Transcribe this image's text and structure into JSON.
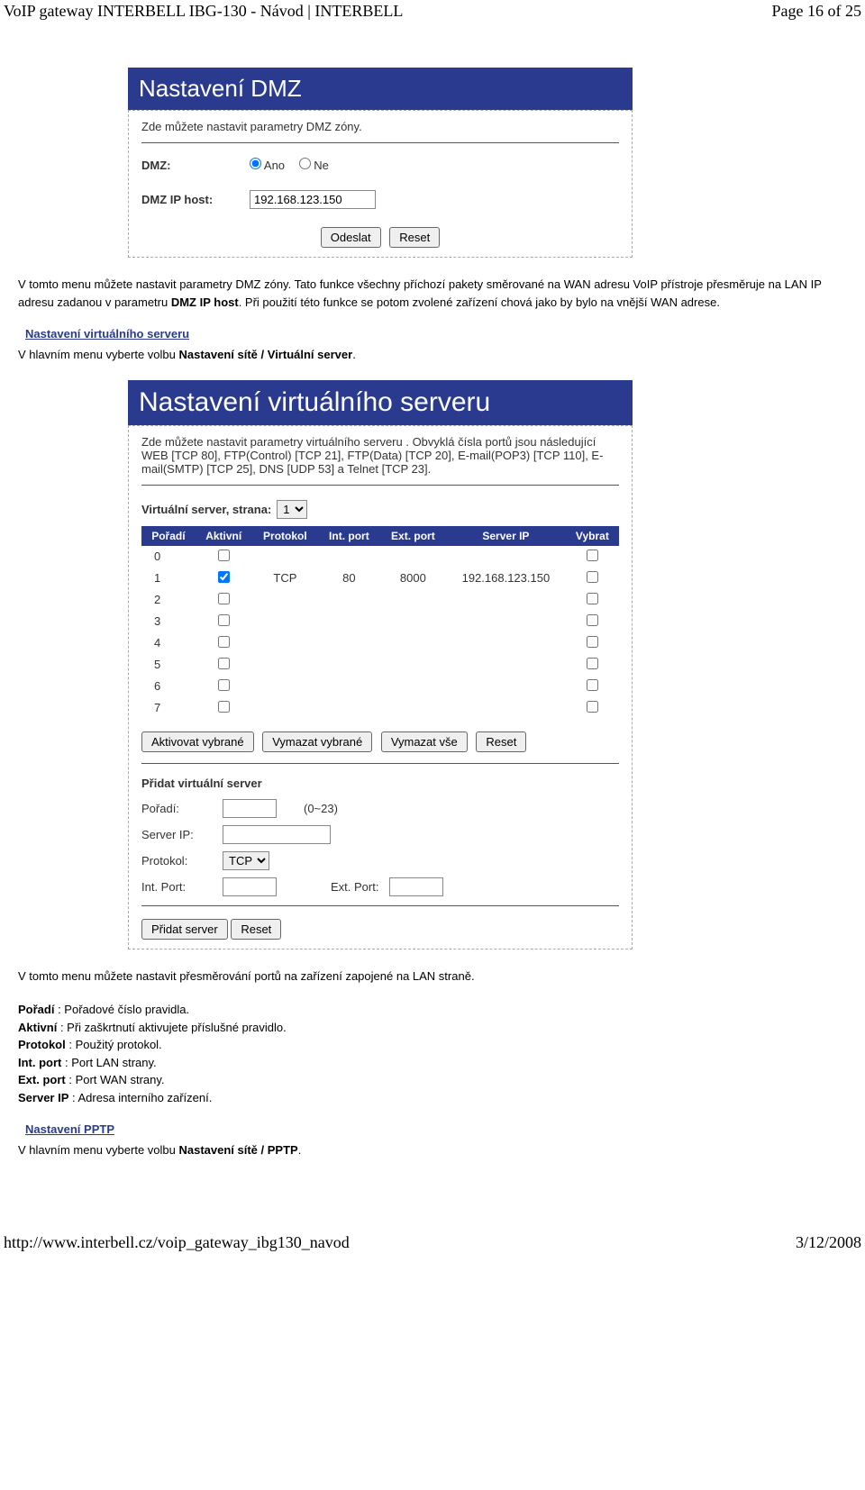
{
  "header": {
    "left": "VoIP gateway INTERBELL IBG-130 - Návod | INTERBELL",
    "right": "Page 16 of 25"
  },
  "footer": {
    "left": "http://www.interbell.cz/voip_gateway_ibg130_navod",
    "right": "3/12/2008"
  },
  "dmz_panel": {
    "title": "Nastavení DMZ",
    "desc": "Zde můžete nastavit parametry DMZ zóny.",
    "dmz_label": "DMZ:",
    "ano": "Ano",
    "ne": "Ne",
    "ip_label": "DMZ IP host:",
    "ip_value": "192.168.123.150",
    "submit": "Odeslat",
    "reset": "Reset"
  },
  "doc1": {
    "p1a": "V tomto menu můžete nastavit parametry DMZ zóny. Tato funkce všechny příchozí pakety směrované na WAN adresu VoIP přístroje přesměruje na LAN IP adresu zadanou v parametru ",
    "p1b": "DMZ IP host",
    "p1c": ". Při použití této funkce se potom zvolené zařízení chová jako by bylo na vnější WAN adrese.",
    "heading": "Nastavení virtuálního serveru",
    "p2a": "V hlavním menu vyberte volbu ",
    "p2b": "Nastavení sítě / Virtuální server",
    "p2c": "."
  },
  "vs_panel": {
    "title": "Nastavení virtuálního serveru",
    "desc": "Zde můžete nastavit parametry virtuálního serveru . Obvyklá čísla portů jsou následující WEB [TCP 80], FTP(Control) [TCP 21], FTP(Data) [TCP 20], E-mail(POP3) [TCP 110], E-mail(SMTP) [TCP 25], DNS [UDP 53] a Telnet [TCP 23].",
    "page_label": "Virtuální server, strana:",
    "page_value": "1",
    "cols": {
      "c1": "Pořadí",
      "c2": "Aktivní",
      "c3": "Protokol",
      "c4": "Int. port",
      "c5": "Ext. port",
      "c6": "Server IP",
      "c7": "Vybrat"
    },
    "rows": [
      {
        "idx": "0",
        "active": false,
        "proto": "",
        "int": "",
        "ext": "",
        "ip": "",
        "sel": false
      },
      {
        "idx": "1",
        "active": true,
        "proto": "TCP",
        "int": "80",
        "ext": "8000",
        "ip": "192.168.123.150",
        "sel": false
      },
      {
        "idx": "2",
        "active": false,
        "proto": "",
        "int": "",
        "ext": "",
        "ip": "",
        "sel": false
      },
      {
        "idx": "3",
        "active": false,
        "proto": "",
        "int": "",
        "ext": "",
        "ip": "",
        "sel": false
      },
      {
        "idx": "4",
        "active": false,
        "proto": "",
        "int": "",
        "ext": "",
        "ip": "",
        "sel": false
      },
      {
        "idx": "5",
        "active": false,
        "proto": "",
        "int": "",
        "ext": "",
        "ip": "",
        "sel": false
      },
      {
        "idx": "6",
        "active": false,
        "proto": "",
        "int": "",
        "ext": "",
        "ip": "",
        "sel": false
      },
      {
        "idx": "7",
        "active": false,
        "proto": "",
        "int": "",
        "ext": "",
        "ip": "",
        "sel": false
      }
    ],
    "btn_activate": "Aktivovat vybrané",
    "btn_delete": "Vymazat vybrané",
    "btn_delete_all": "Vymazat vše",
    "btn_reset": "Reset",
    "add_heading": "Přidat virtuální server",
    "add_poradi": "Pořadí:",
    "add_poradi_hint": "(0~23)",
    "add_serverip": "Server IP:",
    "add_protokol": "Protokol:",
    "add_protokol_value": "TCP",
    "add_intport": "Int. Port:",
    "add_extport": "Ext. Port:",
    "btn_add": "Přidat server",
    "btn_reset2": "Reset"
  },
  "doc2": {
    "p1": "V tomto menu můžete nastavit přesměrování portů na zařízení zapojené na LAN straně.",
    "l1a": "Pořadí",
    "l1b": " : Pořadové číslo pravidla.",
    "l2a": "Aktivní",
    "l2b": " : Při zaškrtnutí aktivujete příslušné pravidlo.",
    "l3a": "Protokol",
    "l3b": " : Použitý protokol.",
    "l4a": "Int. port",
    "l4b": " : Port LAN strany.",
    "l5a": "Ext. port",
    "l5b": " : Port WAN strany.",
    "l6a": "Server IP",
    "l6b": " : Adresa interního zařízení.",
    "heading": "Nastavení PPTP",
    "p2a": "V hlavním menu vyberte volbu ",
    "p2b": "Nastavení sítě / PPTP",
    "p2c": "."
  }
}
